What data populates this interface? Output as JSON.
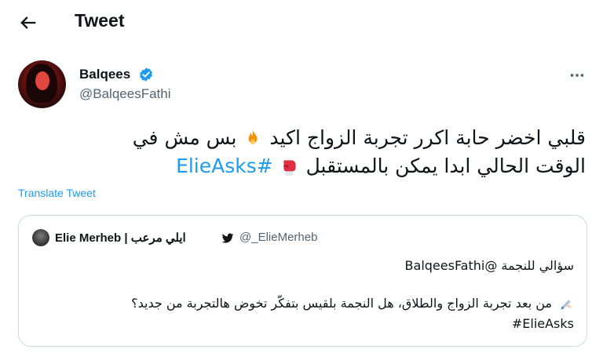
{
  "header": {
    "title": "Tweet"
  },
  "author": {
    "name": "Balqees",
    "handle": "@BalqeesFathi"
  },
  "tweet": {
    "line1_text": "قلبي اخضر حابة اكرر تجربة الزواج اكيد",
    "line1_after": "بس مش في",
    "line2_text": "الوقت الحالي ابدا يمكن بالمستقبل",
    "hashtag": "#ElieAsks",
    "translate_label": "Translate Tweet"
  },
  "quote": {
    "name": "Elie Merheb | ايلي مرعب",
    "handle": "@_ElieMerheb",
    "line1": "سؤالي للنجمة @BalqeesFathi",
    "line2": "من بعد تجربة الزواج والطلاق، هل النجمة بلقيس بتفكّر تخوض هالتجربة من جديد؟",
    "hashtag": "#ElieAsks"
  },
  "icons": {
    "back": "arrow-left-icon",
    "verified": "verified-badge-icon",
    "more": "more-dots-icon",
    "bird": "twitter-bird-icon",
    "fire": "fire-emoji-icon",
    "glove": "boxing-glove-emoji-icon",
    "pen": "writing-hand-emoji-icon"
  },
  "colors": {
    "accent": "#1d9bf0",
    "secondary_text": "#536471",
    "border": "#cfd9de"
  }
}
